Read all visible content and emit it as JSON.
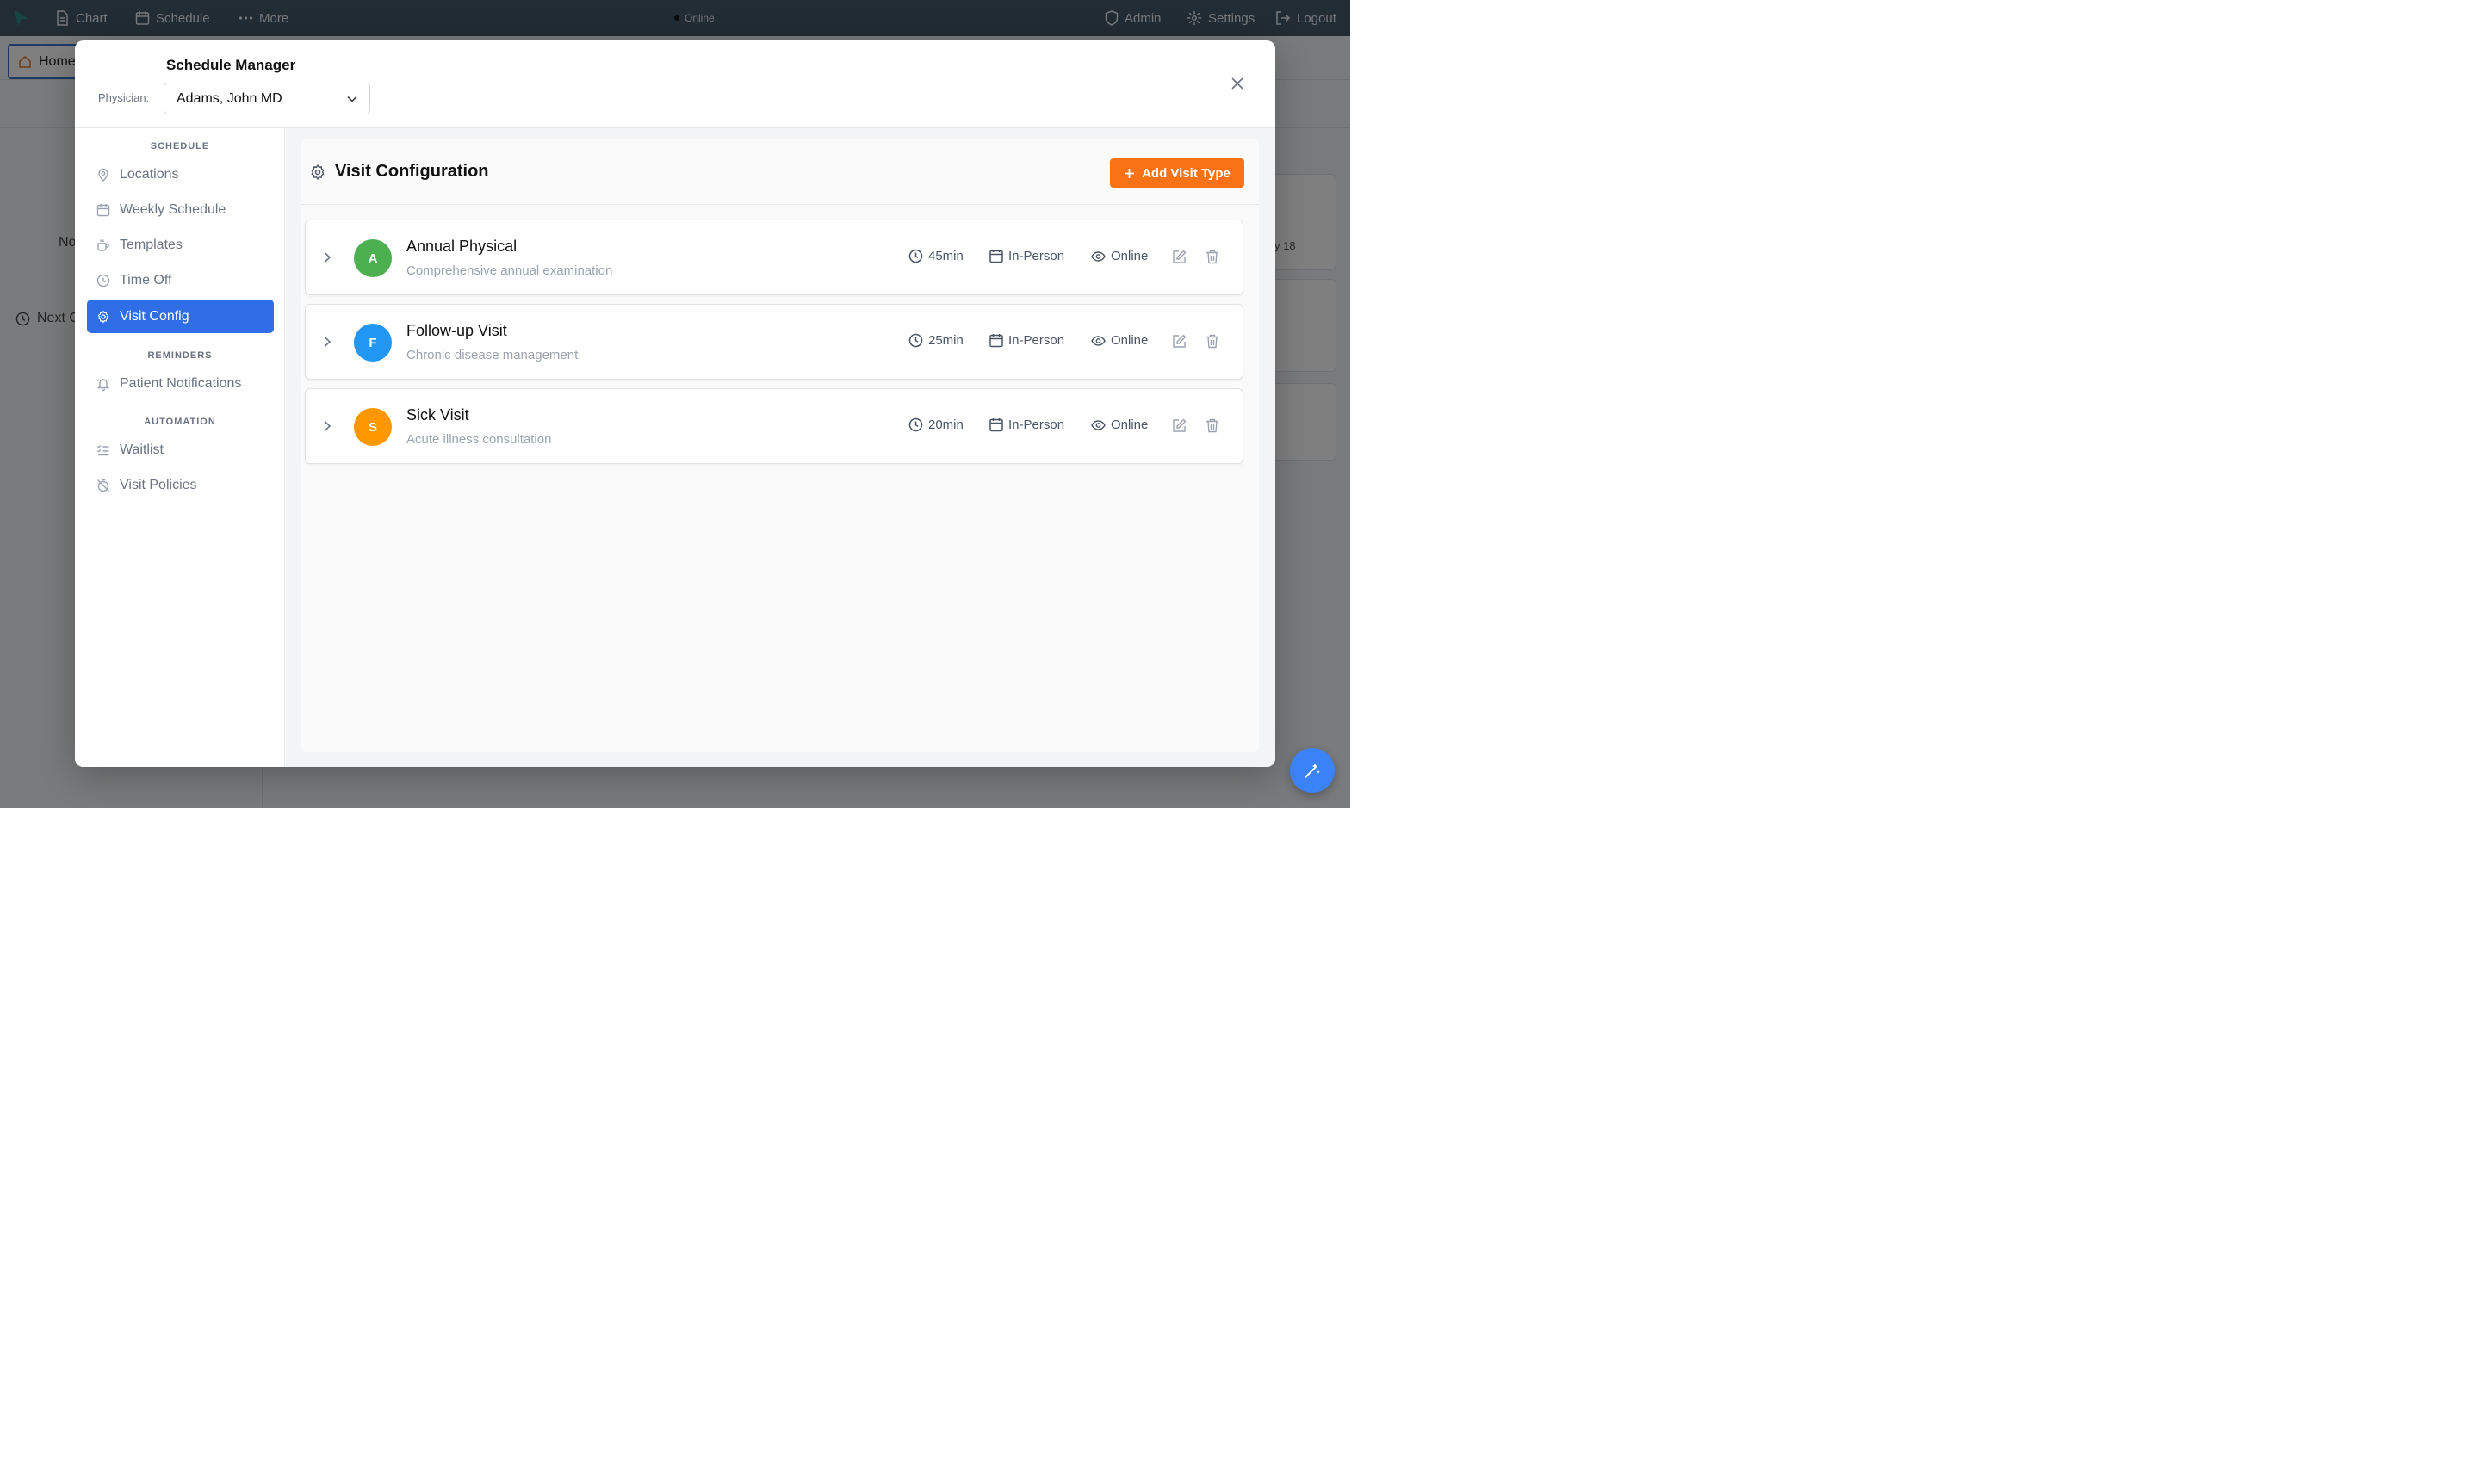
{
  "topbar": {
    "chart_label": "Chart",
    "schedule_label": "Schedule",
    "more_label": "More",
    "status_label": "Online",
    "admin_label": "Admin",
    "settings_label": "Settings",
    "logout_label": "Logout"
  },
  "background": {
    "home_tab_label": "Home",
    "partial_left_text": "No",
    "next_label": "Next C",
    "date_fragment": "y 18"
  },
  "modal": {
    "title": "Schedule Manager",
    "physician_label": "Physician:",
    "physician_value": "Adams, John MD"
  },
  "sidebar": {
    "sections": {
      "schedule": "SCHEDULE",
      "reminders": "REMINDERS",
      "automation": "AUTOMATION"
    },
    "items": [
      {
        "label": "Locations",
        "icon": "map-pin-icon"
      },
      {
        "label": "Weekly Schedule",
        "icon": "calendar-icon"
      },
      {
        "label": "Templates",
        "icon": "coffee-icon"
      },
      {
        "label": "Time Off",
        "icon": "clock-icon"
      },
      {
        "label": "Visit Config",
        "icon": "gear-icon",
        "active": true
      },
      {
        "label": "Patient Notifications",
        "icon": "bell-icon"
      },
      {
        "label": "Waitlist",
        "icon": "list-checks-icon"
      },
      {
        "label": "Visit Policies",
        "icon": "timer-off-icon"
      }
    ]
  },
  "panel": {
    "title": "Visit Configuration",
    "add_button_label": "Add Visit Type"
  },
  "visit_types": [
    {
      "initial": "A",
      "name": "Annual Physical",
      "description": "Comprehensive annual examination",
      "duration": "45min",
      "mode": "In-Person",
      "availability": "Online",
      "color": "#4caf50"
    },
    {
      "initial": "F",
      "name": "Follow-up Visit",
      "description": "Chronic disease management",
      "duration": "25min",
      "mode": "In-Person",
      "availability": "Online",
      "color": "#2196f3"
    },
    {
      "initial": "S",
      "name": "Sick Visit",
      "description": "Acute illness consultation",
      "duration": "20min",
      "mode": "In-Person",
      "availability": "Online",
      "color": "#ff9800"
    }
  ],
  "colors": {
    "accent": "#2f6ee6",
    "add_button": "#f97316",
    "topbar": "#44586a",
    "fab": "#3b82f6"
  }
}
